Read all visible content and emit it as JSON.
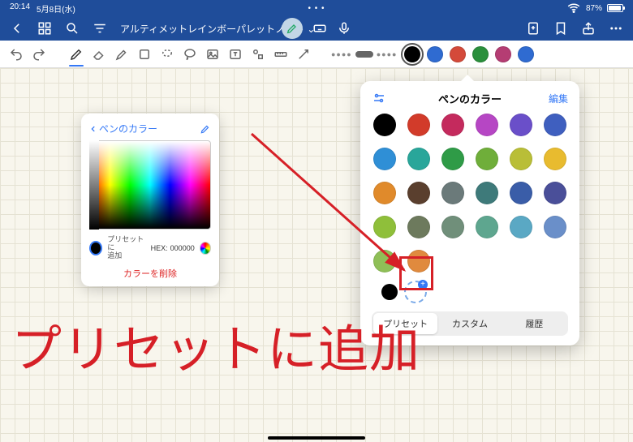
{
  "status": {
    "time": "20:14",
    "date": "5月8日(水)",
    "center_dots": "• • •",
    "wifi": "wifi-icon",
    "battery_pct": "87%"
  },
  "header": {
    "doc_title": "アルティメットレインボーパレットノート",
    "chevron_suffix": "⌄"
  },
  "toolbar": {
    "color_swatches": [
      {
        "hex": "#000000",
        "selected": true
      },
      {
        "hex": "#2f6bd1",
        "selected": false
      },
      {
        "hex": "#d44a3a",
        "selected": false
      },
      {
        "hex": "#2a8f3c",
        "selected": false
      },
      {
        "hex": "#b53d73",
        "selected": false
      },
      {
        "hex": "#2f6bd1",
        "selected": false
      }
    ]
  },
  "spectrum_popover": {
    "back_label": "ペンのカラー",
    "preset_add_label_l1": "プリセットに",
    "preset_add_label_l2": "追加",
    "hex_label": "HEX:",
    "hex_value": "000000",
    "delete_label": "カラーを削除"
  },
  "preset_popover": {
    "title": "ペンのカラー",
    "edit_label": "編集",
    "swatches": [
      "#000000",
      "#d23b2a",
      "#c42a5d",
      "#b646c4",
      "#6a4fc9",
      "#3f5fbf",
      "#2f8fd6",
      "#29a69a",
      "#2f9b47",
      "#6fae3a",
      "#b9be37",
      "#e8bb2f",
      "#e08a2b",
      "#5a3f2e",
      "#6b7a7a",
      "#3e7a7a",
      "#3a5da8",
      "#4a4f99",
      "#8fbf3a",
      "#6d7a5d",
      "#708f7a",
      "#5ea68f",
      "#5aa8c4",
      "#6a8fc9",
      "#8fbf57",
      "#e08a3e"
    ],
    "segments": {
      "preset": "プリセット",
      "custom": "カスタム",
      "history": "履歴"
    }
  },
  "caption": "プリセットに追加"
}
